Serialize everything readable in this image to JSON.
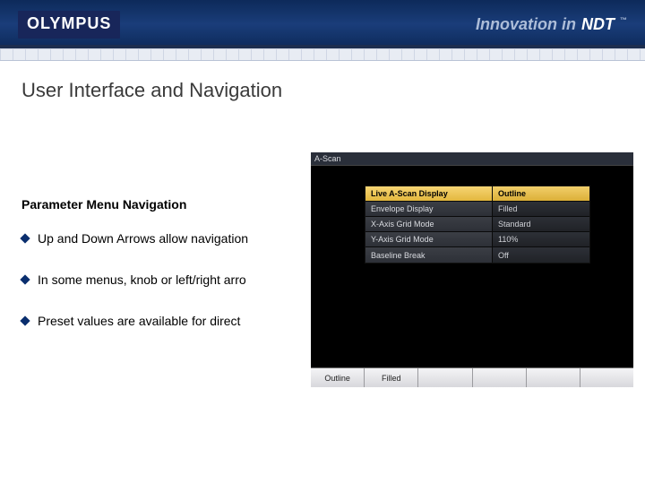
{
  "header": {
    "logo": "OLYMPUS",
    "tagline_prefix": "Innovation in",
    "tagline_emph": "NDT",
    "tagline_tm": "™"
  },
  "title": "User Interface and Navigation",
  "subheading": "Parameter Menu Navigation",
  "bullets": [
    "Up and Down Arrows allow navigation",
    "In some menus, knob or left/right arro",
    "Preset values are available for direct"
  ],
  "device": {
    "titlebar": "A-Scan",
    "params": [
      {
        "label": "Live A-Scan Display",
        "value": "Outline",
        "selected": true
      },
      {
        "label": "Envelope Display",
        "value": "Filled",
        "selected": false
      },
      {
        "label": "X-Axis Grid Mode",
        "value": "Standard",
        "selected": false
      },
      {
        "label": "Y-Axis Grid Mode",
        "value": "110%",
        "selected": false
      },
      {
        "label": "Baseline Break",
        "value": "Off",
        "selected": false
      }
    ],
    "softkeys": [
      "Outline",
      "Filled",
      "",
      "",
      "",
      ""
    ]
  }
}
